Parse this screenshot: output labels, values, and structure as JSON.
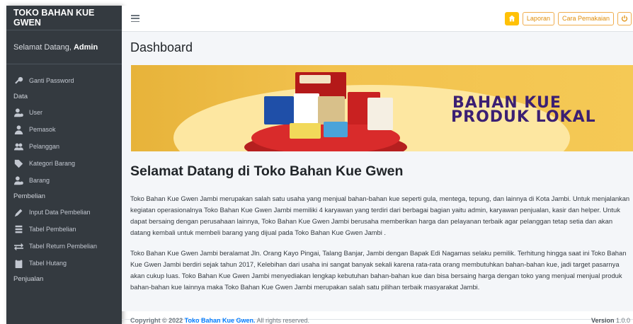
{
  "brand": "TOKO BAHAN KUE GWEN",
  "welcome": {
    "prefix": "Selamat Datang,",
    "user": "Admin"
  },
  "sidebar": {
    "items": [
      {
        "type": "item",
        "label": "Ganti Password",
        "icon": "key-icon"
      },
      {
        "type": "header",
        "label": "Data"
      },
      {
        "type": "item",
        "label": "User",
        "icon": "user-cog-icon"
      },
      {
        "type": "item",
        "label": "Pemasok",
        "icon": "user-tie-icon"
      },
      {
        "type": "item",
        "label": "Pelanggan",
        "icon": "users-icon"
      },
      {
        "type": "item",
        "label": "Kategori Barang",
        "icon": "tag-icon"
      },
      {
        "type": "item",
        "label": "Barang",
        "icon": "user-cog-icon"
      },
      {
        "type": "header",
        "label": "Pembelian"
      },
      {
        "type": "item",
        "label": "Input Data Pembelian",
        "icon": "pen-icon"
      },
      {
        "type": "item",
        "label": "Tabel Pembelian",
        "icon": "list-icon"
      },
      {
        "type": "item",
        "label": "Tabel Return Pembelian",
        "icon": "exchange-icon"
      },
      {
        "type": "item",
        "label": "Tabel Hutang",
        "icon": "clipboard-icon"
      },
      {
        "type": "header",
        "label": "Penjualan"
      }
    ]
  },
  "navbar": {
    "laporan": "Laporan",
    "cara": "Cara Pemakaian"
  },
  "page_title": "Dashboard",
  "banner": {
    "line1": "BAHAN KUE",
    "line2": "PRODUK LOKAL"
  },
  "welcome_title": "Selamat Datang di Toko Bahan Kue Gwen",
  "paragraph1": "Toko Bahan Kue Gwen Jambi merupakan salah satu usaha yang menjual bahan-bahan kue seperti gula, mentega, tepung, dan lainnya di Kota Jambi. Untuk menjalankan kegiatan operasionalnya Toko Bahan Kue Gwen Jambi memiliki 4 karyawan yang terdiri dari berbagai bagian yaitu admin, karyawan penjualan, kasir dan helper. Untuk dapat bersaing dengan perusahaan lainnya, Toko Bahan Kue Gwen Jambi berusaha memberikan harga dan pelayanan terbaik agar pelanggan tetap setia dan akan datang kembali untuk membeli barang yang dijual pada Toko Bahan Kue Gwen Jambi .",
  "paragraph2": "Toko Bahan Kue Gwen Jambi beralamat Jln. Orang Kayo Pingai, Talang Banjar, Jambi dengan Bapak Edi Nagamas selaku pemilik. Terhitung hingga saat ini Toko Bahan Kue Gwen Jambi berdiri sejak tahun 2017, Kelebihan dari usaha ini sangat banyak sekali karena rata-rata orang membutuhkan bahan-bahan kue, jadi target pasarnya akan cukup luas. Toko Bahan Kue Gwen Jambi menyediakan lengkap kebutuhan bahan-bahan kue dan bisa bersaing harga dengan toko yang menjual menjual produk bahan-bahan kue lainnya maka Toko Bahan Kue Gwen Jambi merupakan salah satu pilihan terbaik masyarakat Jambi.",
  "footer": {
    "copyright_prefix": "Copyright © 2022",
    "copyright_link": "Toko Bahan Kue Gwen.",
    "copyright_suffix": "All rights reserved.",
    "version_label": "Version",
    "version_value": "1.0.0"
  }
}
